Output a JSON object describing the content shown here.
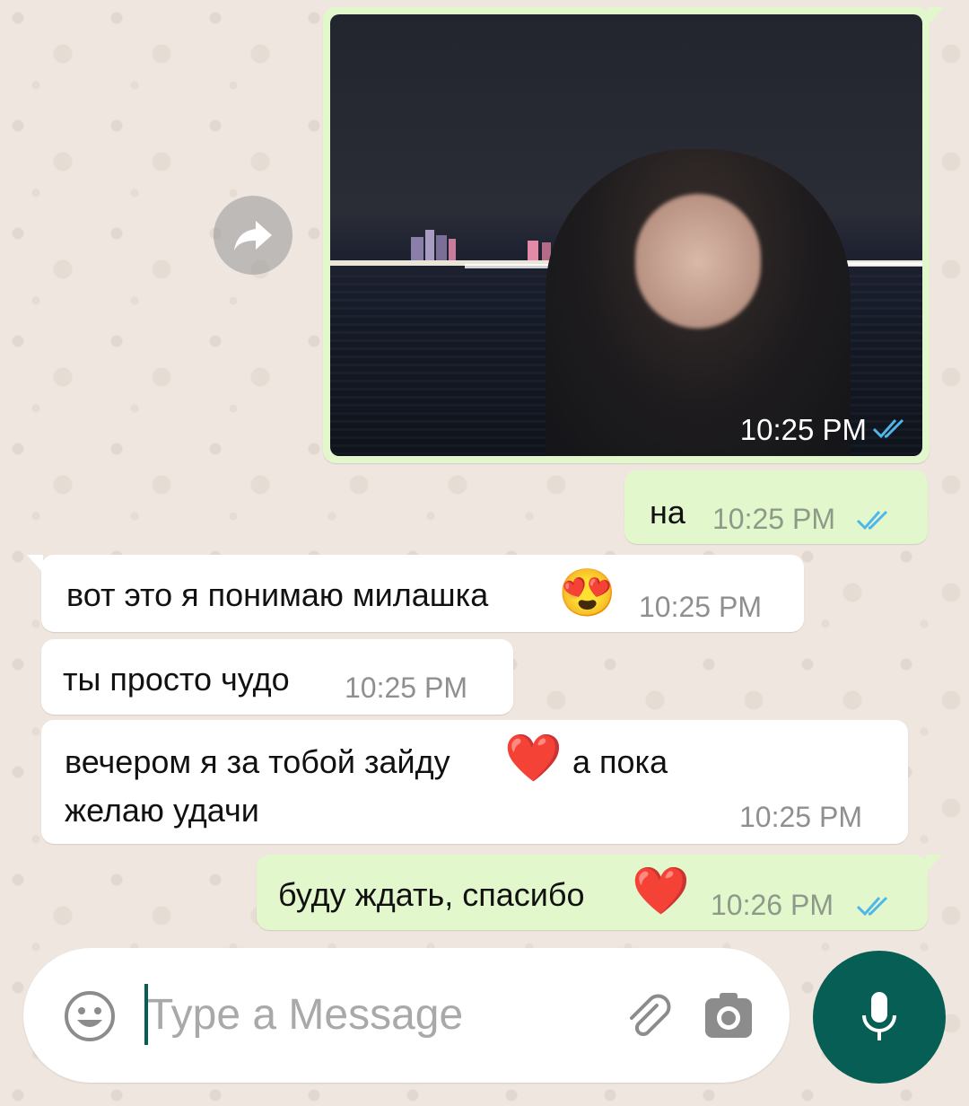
{
  "messages": [
    {
      "type": "photo",
      "direction": "outgoing",
      "time": "10:25 PM",
      "status": "read"
    },
    {
      "type": "text",
      "direction": "outgoing",
      "text": "на",
      "time": "10:25 PM",
      "status": "read"
    },
    {
      "type": "text",
      "direction": "incoming",
      "text": "вот это я понимаю милашка",
      "emoji": "😍",
      "time": "10:25 PM"
    },
    {
      "type": "text",
      "direction": "incoming",
      "text": "ты просто чудо",
      "time": "10:25 PM"
    },
    {
      "type": "text",
      "direction": "incoming",
      "line1_before": "вечером я за тобой зайду",
      "emoji": "❤️",
      "line1_after": "а пока",
      "line2": "желаю удачи",
      "time": "10:25 PM"
    },
    {
      "type": "text",
      "direction": "outgoing",
      "text": "буду ждать, спасибо",
      "emoji": "❤️",
      "time": "10:26 PM",
      "status": "read"
    }
  ],
  "input": {
    "placeholder": "Type a Message",
    "emoji_icon": "smiley-icon",
    "attach_icon": "paperclip-icon",
    "camera_icon": "camera-icon",
    "mic_icon": "microphone-icon"
  },
  "forward_icon": "forward-arrow-icon",
  "colors": {
    "outgoing_bubble": "#e2f7cb",
    "incoming_bubble": "#ffffff",
    "read_ticks": "#4fb6ec",
    "accent": "#075e54",
    "background": "#efe7df"
  }
}
